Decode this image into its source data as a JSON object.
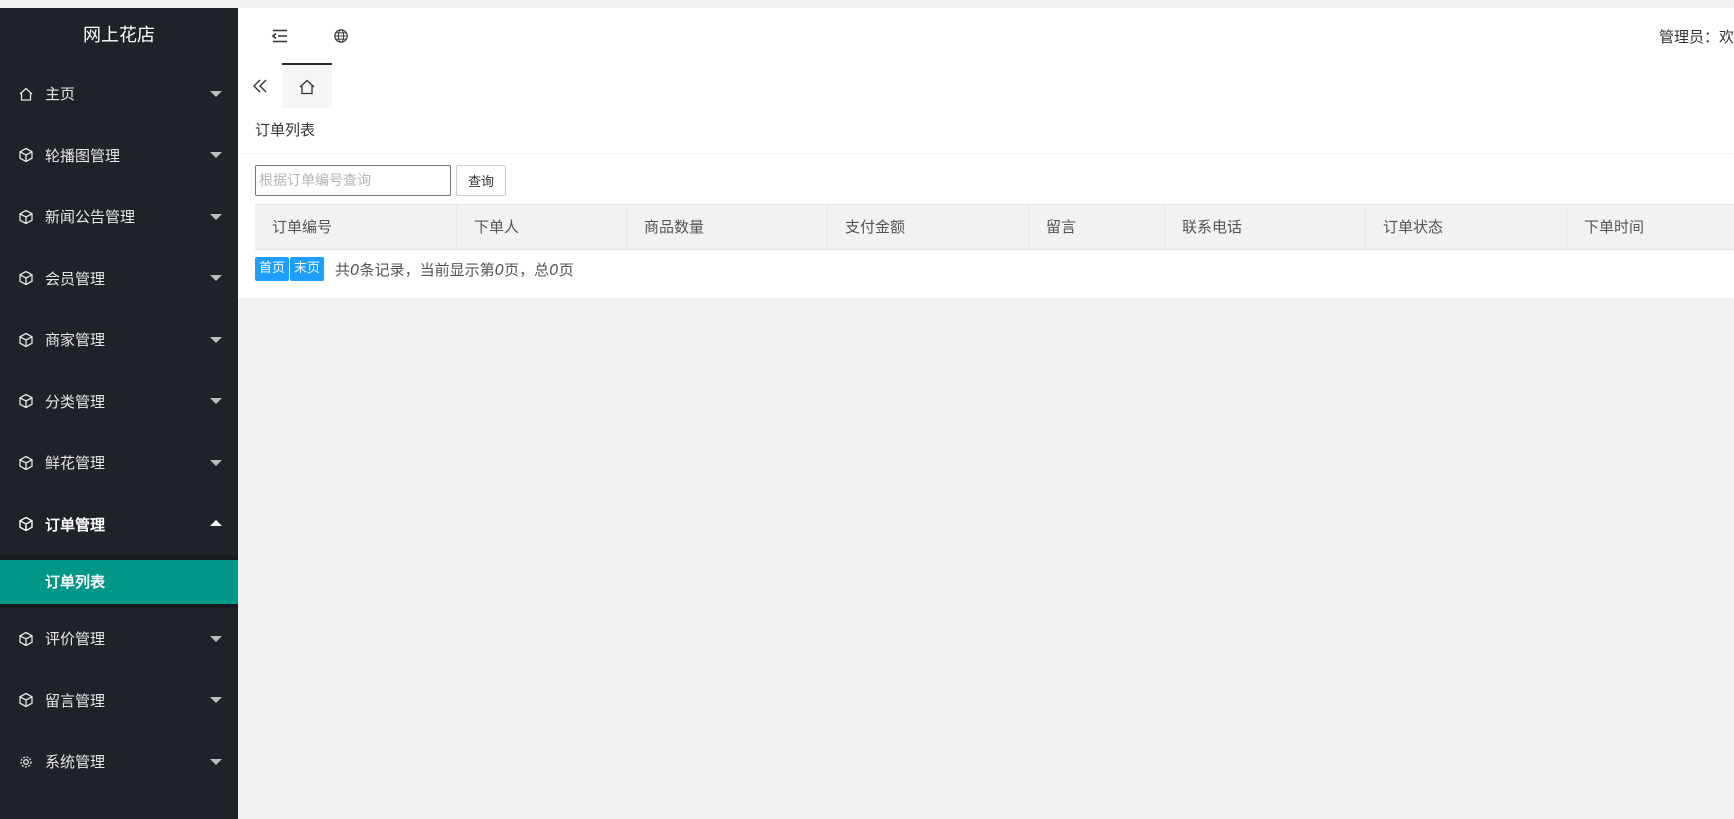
{
  "app": {
    "title": "网上花店"
  },
  "sidebar": {
    "items": [
      {
        "label": "主页",
        "icon": "home-icon"
      },
      {
        "label": "轮播图管理",
        "icon": "cube-icon"
      },
      {
        "label": "新闻公告管理",
        "icon": "cube-icon"
      },
      {
        "label": "会员管理",
        "icon": "cube-icon"
      },
      {
        "label": "商家管理",
        "icon": "cube-icon"
      },
      {
        "label": "分类管理",
        "icon": "cube-icon"
      },
      {
        "label": "鲜花管理",
        "icon": "cube-icon"
      },
      {
        "label": "订单管理",
        "icon": "cube-icon",
        "open": true,
        "children": [
          {
            "label": "订单列表",
            "active": true
          }
        ]
      },
      {
        "label": "评价管理",
        "icon": "cube-icon"
      },
      {
        "label": "留言管理",
        "icon": "cube-icon"
      },
      {
        "label": "系统管理",
        "icon": "gear-icon"
      }
    ]
  },
  "header": {
    "admin_text": "管理员：欢"
  },
  "card": {
    "title": "订单列表",
    "search": {
      "placeholder": "根据订单编号查询",
      "value": "",
      "button": "查询"
    },
    "columns": [
      "订单编号",
      "下单人",
      "商品数量",
      "支付金额",
      "留言",
      "联系电话",
      "订单状态",
      "下单时间"
    ],
    "pager": {
      "first": "首页",
      "last": "末页",
      "total_records": "0",
      "current_page": "0",
      "total_pages": "0",
      "text_prefix": "共",
      "text_records": "条记录，当前显示第",
      "text_page": "页，总",
      "text_suffix": "页"
    }
  },
  "colors": {
    "sidebar_bg": "#20222a",
    "active_bg": "#009688",
    "pager_btn": "#1e9fff"
  }
}
